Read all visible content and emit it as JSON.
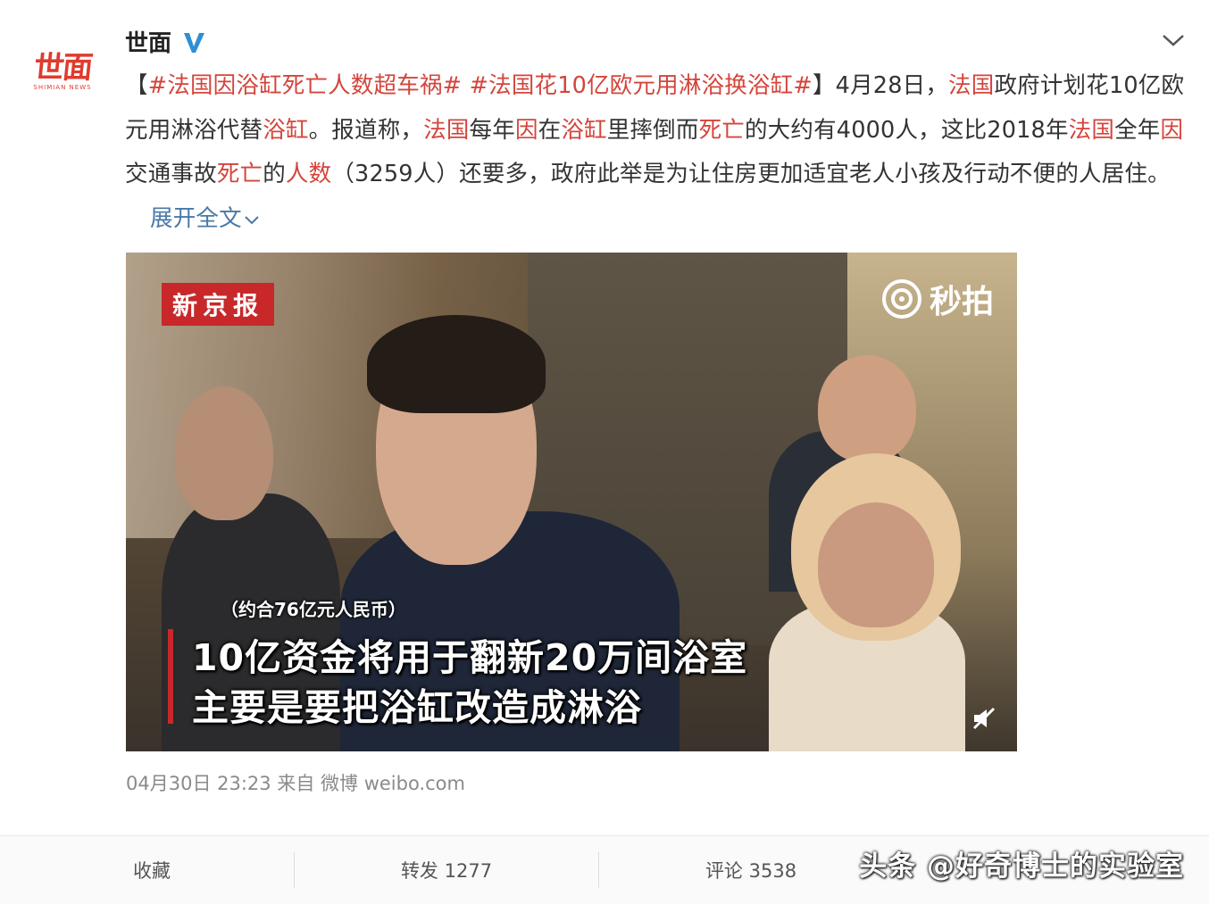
{
  "account": {
    "avatar_text": "世面",
    "avatar_sub": "SHIMIAN NEWS",
    "name": "世面"
  },
  "post": {
    "bracket_open": "【",
    "hashtag_1": "#法国因浴缸死亡人数超车祸#",
    "hashtag_2": "#法国花10亿欧元用淋浴换浴缸#",
    "bracket_close": "】",
    "t1": "4月28日，",
    "kw_france_1": "法国",
    "t2": "政府计划花10亿欧元用淋浴代替",
    "kw_tub_1": "浴缸",
    "t3": "。报道称，",
    "kw_france_2": "法国",
    "t4": "每年",
    "kw_yin_1": "因",
    "t5": "在",
    "kw_tub_2": "浴缸",
    "t6": "里摔倒而",
    "kw_death_1": "死亡",
    "t7": "的大约有4000人，这比2018年",
    "kw_france_3": "法国",
    "t8": "全年",
    "kw_yin_2": "因",
    "t9": "交通事故",
    "kw_death_2": "死亡",
    "t10": "的",
    "kw_count": "人数",
    "t11": "（3259人）还要多，政府此举是为让住房更加适宜老人小孩及行动不便的人居住。",
    "expand_label": "展开全文"
  },
  "video": {
    "source_badge": "新京报",
    "platform": "秒拍",
    "caption_small": "（约合76亿元人民币）",
    "caption_line_1": "10亿资金将用于翻新20万间浴室",
    "caption_line_2": "主要是要把浴缸改造成淋浴"
  },
  "meta": {
    "timestamp": "04月30日 23:23",
    "from_label": "来自",
    "source": "微博 weibo.com"
  },
  "actions": {
    "favorite": "收藏",
    "repost": "转发 1277",
    "comment": "评论 3538"
  },
  "watermark": "头条 @好奇博士的实验室",
  "colors": {
    "keyword": "#d4453c",
    "expand_link": "#4a78a8",
    "verified": "#2d8fd5",
    "badge_red": "#c8282a"
  }
}
